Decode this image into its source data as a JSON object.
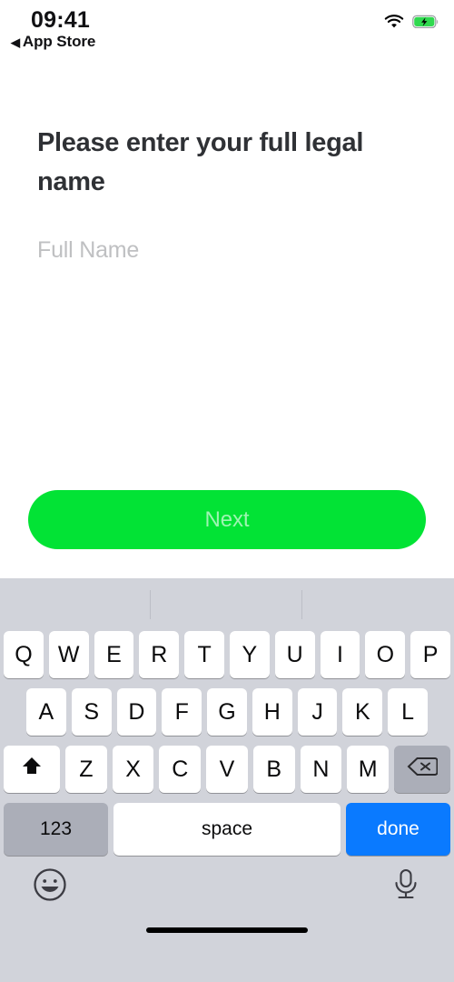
{
  "status_bar": {
    "time": "09:41",
    "back_label": "App Store",
    "back_caret": "◀",
    "wifi_icon": "wifi-icon",
    "battery_icon": "battery-charging-icon",
    "battery_color": "#30d94f"
  },
  "screen": {
    "headline": "Please enter your full legal name",
    "field": {
      "placeholder": "Full Name",
      "value": ""
    },
    "primary_button": {
      "label": "Next",
      "color": "#02e335",
      "text_color": "rgba(255,255,255,0.62)",
      "state": "disabled"
    }
  },
  "keyboard": {
    "type": "alphabetic-uppercase",
    "background": "#d1d3da",
    "predictive_bar": {
      "suggestions": []
    },
    "rows": {
      "row1": [
        "Q",
        "W",
        "E",
        "R",
        "T",
        "Y",
        "U",
        "I",
        "O",
        "P"
      ],
      "row2": [
        "A",
        "S",
        "D",
        "F",
        "G",
        "H",
        "J",
        "K",
        "L"
      ],
      "row3": [
        "Z",
        "X",
        "C",
        "V",
        "B",
        "N",
        "M"
      ]
    },
    "shift": {
      "icon": "shift-arrow-up-icon",
      "state": "active"
    },
    "backspace": {
      "icon": "backspace-delete-icon"
    },
    "bottom_row": {
      "numeric_label": "123",
      "space_label": "space",
      "done_label": "done",
      "done_color": "#0a7aff"
    },
    "bottom_bar": {
      "emoji_icon": "smiley-face-icon",
      "mic_icon": "microphone-icon"
    }
  }
}
